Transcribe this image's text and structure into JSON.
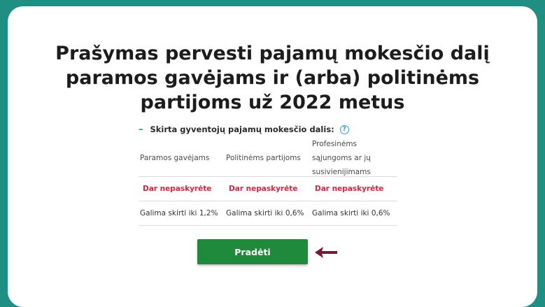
{
  "colors": {
    "background": "#1e8f82",
    "card": "#ffffff",
    "accent_green": "#1f8a3c",
    "warning_red": "#d9263c",
    "help_blue": "#2f9ad6",
    "arrow": "#7a1732"
  },
  "heading": {
    "line1": "Prašymas pervesti pajamų mokesčio dalį",
    "line2": "paramos gavėjams ir (arba) politinėms",
    "line3": "partijoms už 2022 metus"
  },
  "section": {
    "collapse_icon": "minus-icon",
    "title": "Skirta gyventojų pajamų mokesčio dalis:",
    "help_icon": "question-mark-icon",
    "help_glyph": "?"
  },
  "table": {
    "columns": [
      "Paramos gavėjams",
      "Politinėms partijoms",
      "Profesinėms sąjungoms ar jų susivienijimams"
    ],
    "status": [
      "Dar nepaskyrėte",
      "Dar nepaskyrėte",
      "Dar nepaskyrėte"
    ],
    "limits": [
      "Galima skirti iki 1,2%",
      "Galima skirti iki 0,6%",
      "Galima skirti iki 0,6%"
    ]
  },
  "start_button": {
    "label": "Pradėti"
  },
  "pointer": {
    "icon": "arrow-left-icon"
  }
}
